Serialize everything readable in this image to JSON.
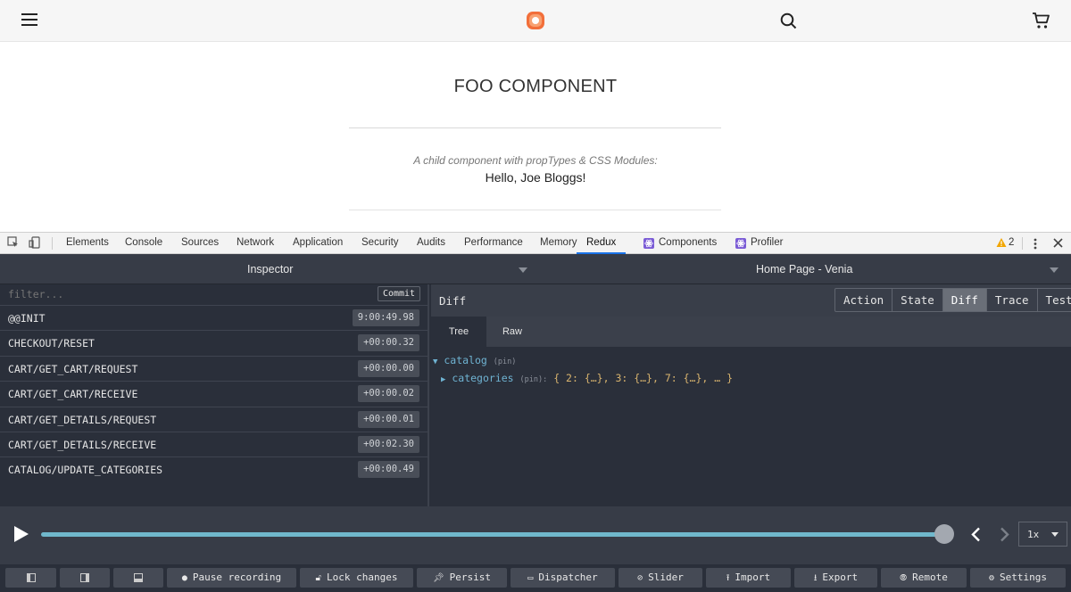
{
  "site": {
    "page_title": "FOO COMPONENT",
    "subtitle": "A child component with propTypes & CSS Modules:",
    "greeting": "Hello, Joe Bloggs!",
    "accent": "#f26f3a"
  },
  "devtools": {
    "tabs": [
      {
        "label": "Elements"
      },
      {
        "label": "Console"
      },
      {
        "label": "Sources"
      },
      {
        "label": "Network"
      },
      {
        "label": "Application"
      },
      {
        "label": "Security"
      },
      {
        "label": "Audits"
      },
      {
        "label": "Performance"
      },
      {
        "label": "Memory"
      },
      {
        "label": "Redux",
        "active": true
      },
      {
        "label": "Components",
        "icon": "react-icon"
      },
      {
        "label": "Profiler",
        "icon": "react-icon"
      }
    ],
    "warning_count": "2"
  },
  "redux": {
    "inspector_label": "Inspector",
    "instance_label": "Home Page - Venia",
    "filter_placeholder": "filter...",
    "commit_label": "Commit",
    "actions": [
      {
        "name": "@@INIT",
        "time": "9:00:49.98"
      },
      {
        "name": "CHECKOUT/RESET",
        "time": "+00:00.32"
      },
      {
        "name": "CART/GET_CART/REQUEST",
        "time": "+00:00.00"
      },
      {
        "name": "CART/GET_CART/RECEIVE",
        "time": "+00:00.02"
      },
      {
        "name": "CART/GET_DETAILS/REQUEST",
        "time": "+00:00.01"
      },
      {
        "name": "CART/GET_DETAILS/RECEIVE",
        "time": "+00:02.30"
      },
      {
        "name": "CATALOG/UPDATE_CATEGORIES",
        "time": "+00:00.49"
      }
    ],
    "monitor_title": "Diff",
    "monitor_tabs": [
      {
        "label": "Action"
      },
      {
        "label": "State"
      },
      {
        "label": "Diff",
        "active": true
      },
      {
        "label": "Trace"
      },
      {
        "label": "Test"
      }
    ],
    "sub_tabs": [
      {
        "label": "Tree",
        "active": true
      },
      {
        "label": "Raw"
      }
    ],
    "tree": {
      "root_key": "catalog",
      "root_tag": "(pin)",
      "child_key": "categories",
      "child_tag": "(pin):",
      "child_value": "{ 2: {…}, 3: {…}, 7: {…}, … }"
    },
    "slider": {
      "position": 1.0
    },
    "speed": "1x",
    "bottom_buttons": [
      {
        "label": "Pause recording",
        "icon": "record-icon"
      },
      {
        "label": "Lock changes",
        "icon": "lock-icon"
      },
      {
        "label": "Persist",
        "icon": "pin-icon"
      },
      {
        "label": "Dispatcher",
        "icon": "keyboard-icon"
      },
      {
        "label": "Slider",
        "icon": "slider-icon"
      },
      {
        "label": "Import",
        "icon": "upload-icon"
      },
      {
        "label": "Export",
        "icon": "download-icon"
      },
      {
        "label": "Remote",
        "icon": "antenna-icon"
      },
      {
        "label": "Settings",
        "icon": "gear-icon"
      }
    ]
  }
}
